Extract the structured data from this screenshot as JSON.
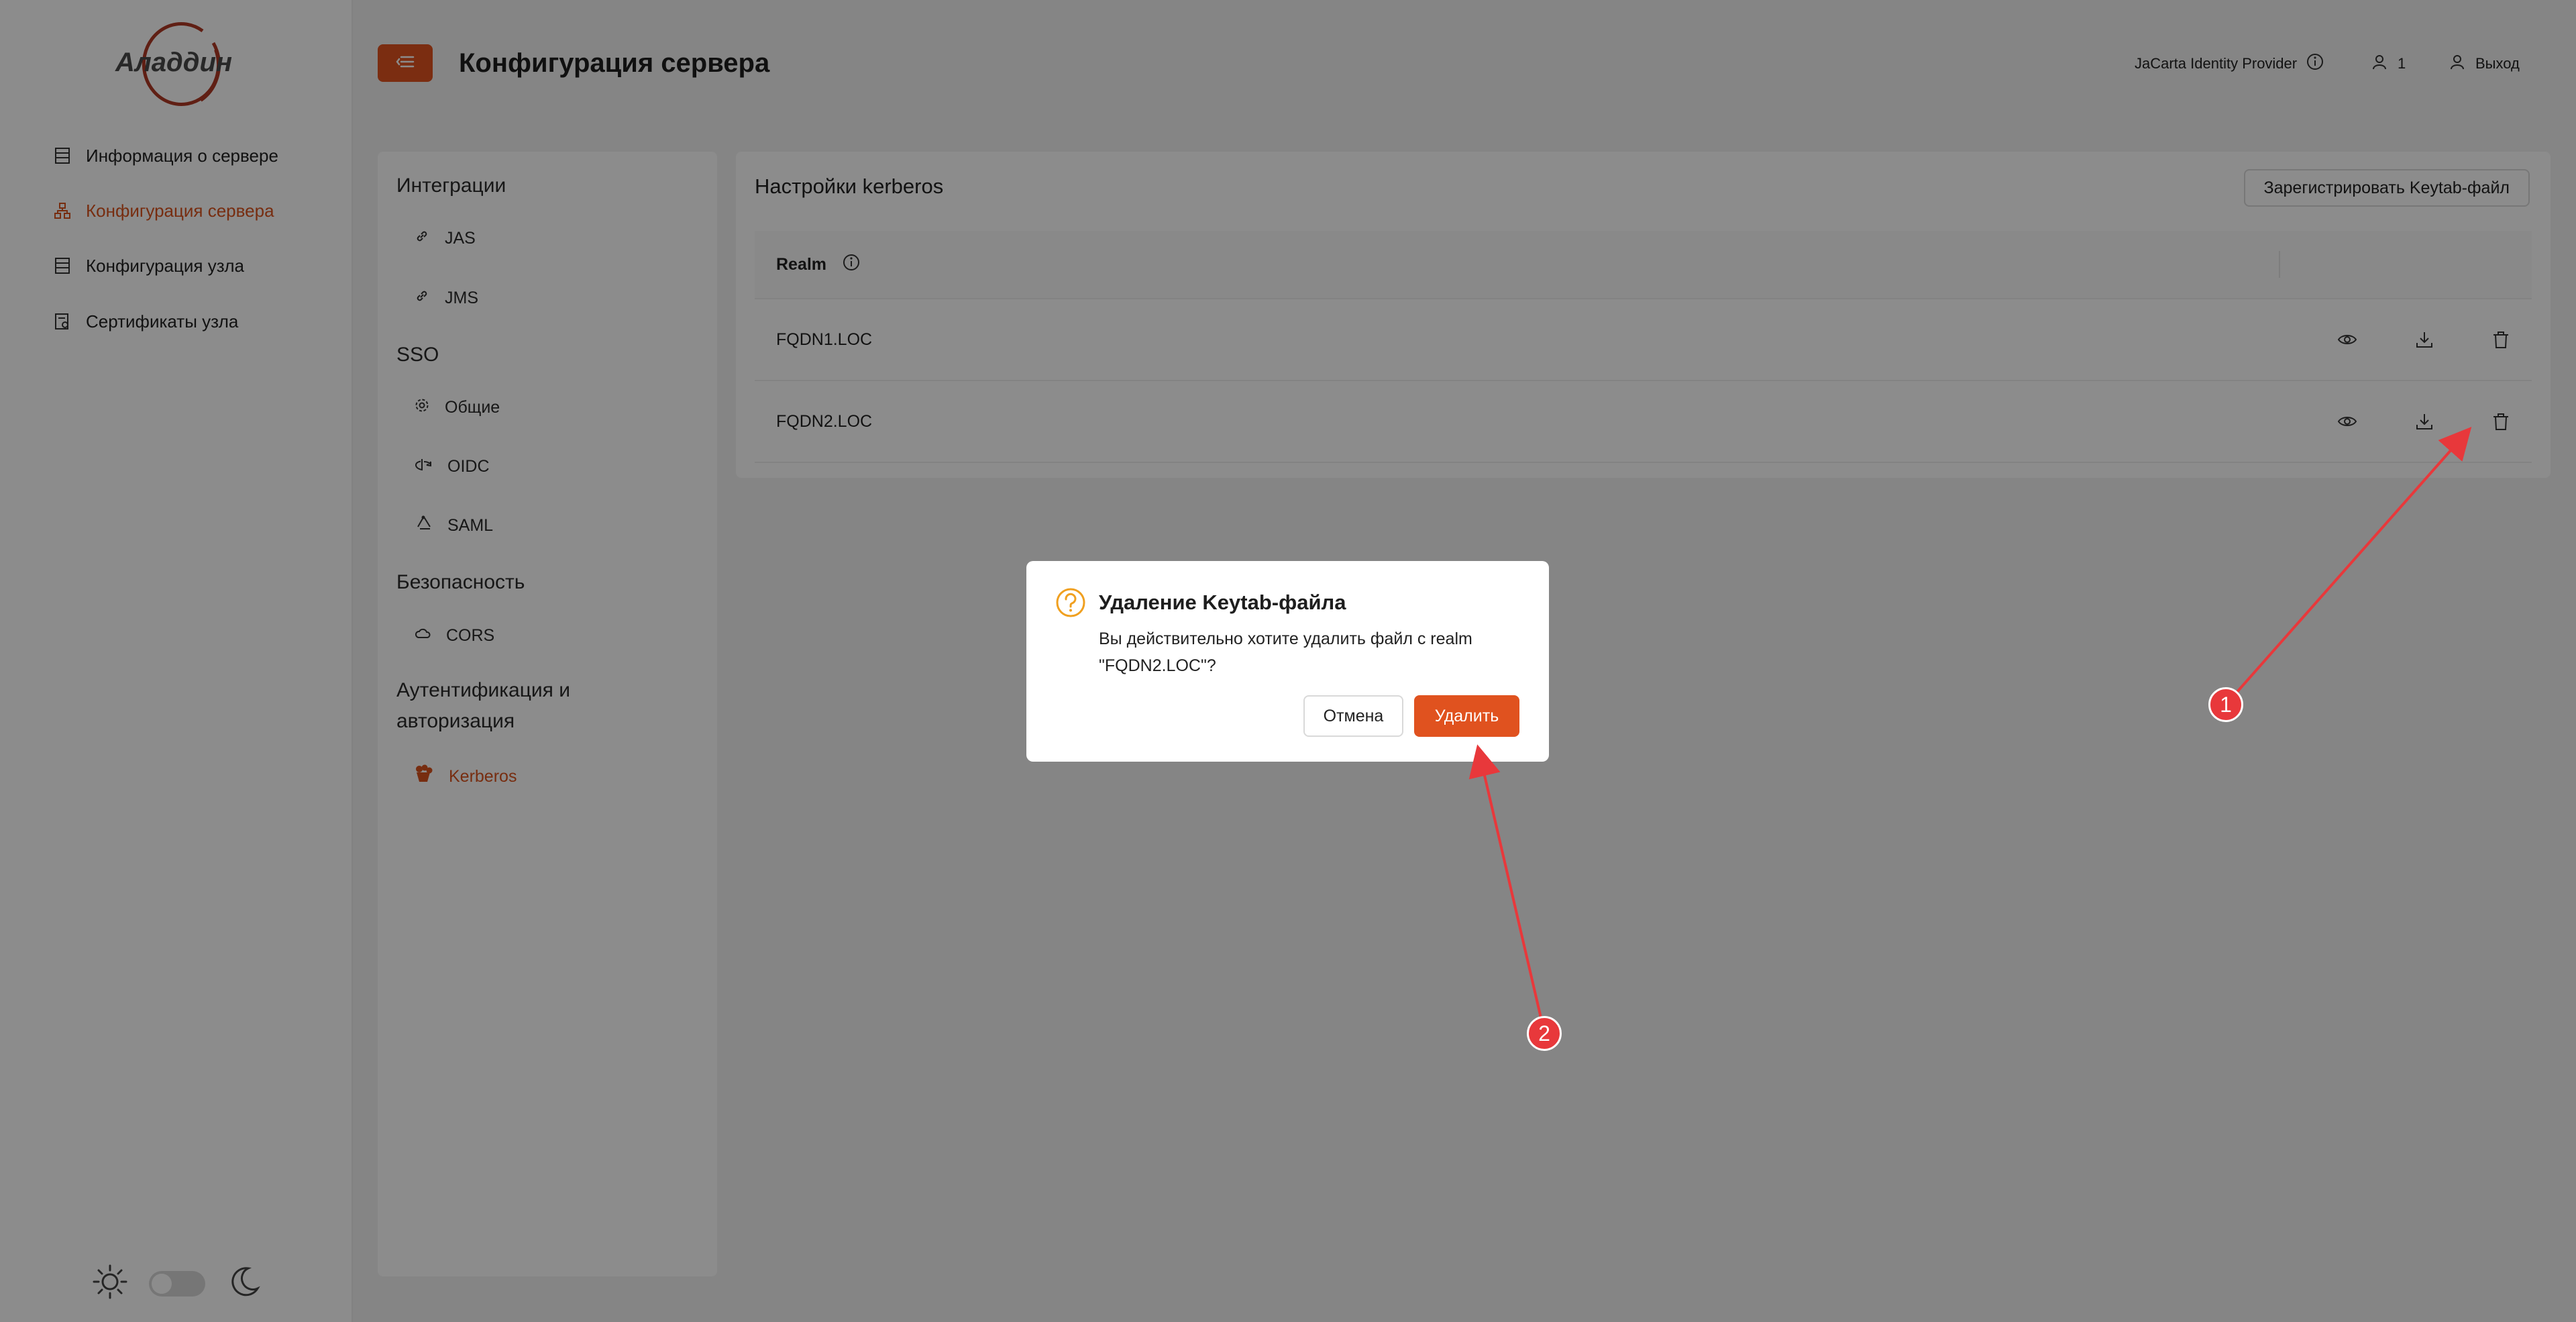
{
  "app": {
    "logo_text": "Аладдин",
    "brand_color": "#e0521f",
    "page_title": "Конфигурация сервера"
  },
  "sidebar": {
    "items": [
      {
        "label": "Информация о сервере",
        "icon": "server-info-icon",
        "active": false
      },
      {
        "label": "Конфигурация сервера",
        "icon": "server-config-icon",
        "active": true
      },
      {
        "label": "Конфигурация узла",
        "icon": "node-config-icon",
        "active": false
      },
      {
        "label": "Сертификаты узла",
        "icon": "certificate-icon",
        "active": false
      }
    ],
    "theme_toggle": {
      "light_icon": "sun-icon",
      "dark_icon": "moon-icon",
      "state": "light"
    }
  },
  "header": {
    "menu_icon": "menu-toggle-icon",
    "provider_label": "JaCarta Identity Provider",
    "user_count": "1",
    "logout_label": "Выход"
  },
  "sections": {
    "integrations_title": "Интеграции",
    "integrations_items": [
      "JAS",
      "JMS"
    ],
    "sso_title": "SSO",
    "sso_items": [
      "Общие",
      "OIDC",
      "SAML"
    ],
    "security_title": "Безопасность",
    "security_items": [
      "CORS"
    ],
    "auth_title_line1": "Аутентификация и",
    "auth_title_line2": "авторизация",
    "auth_items": [
      "Kerberos"
    ]
  },
  "kerberos": {
    "title": "Настройки kerberos",
    "register_button": "Зарегистрировать Keytab-файл",
    "column_realm": "Realm",
    "rows": [
      {
        "realm": "FQDN1.LOC"
      },
      {
        "realm": "FQDN2.LOC"
      }
    ],
    "row_action_icons": [
      "eye-icon",
      "download-icon",
      "trash-icon"
    ]
  },
  "modal": {
    "title": "Удаление Keytab-файла",
    "message": "Вы действительно хотите удалить файл с realm \"FQDN2.LOC\"?",
    "cancel_label": "Отмена",
    "confirm_label": "Удалить",
    "icon": "question-circle-icon"
  },
  "annotations": {
    "markers": [
      "1",
      "2"
    ],
    "marker_color": "#e8383b"
  }
}
